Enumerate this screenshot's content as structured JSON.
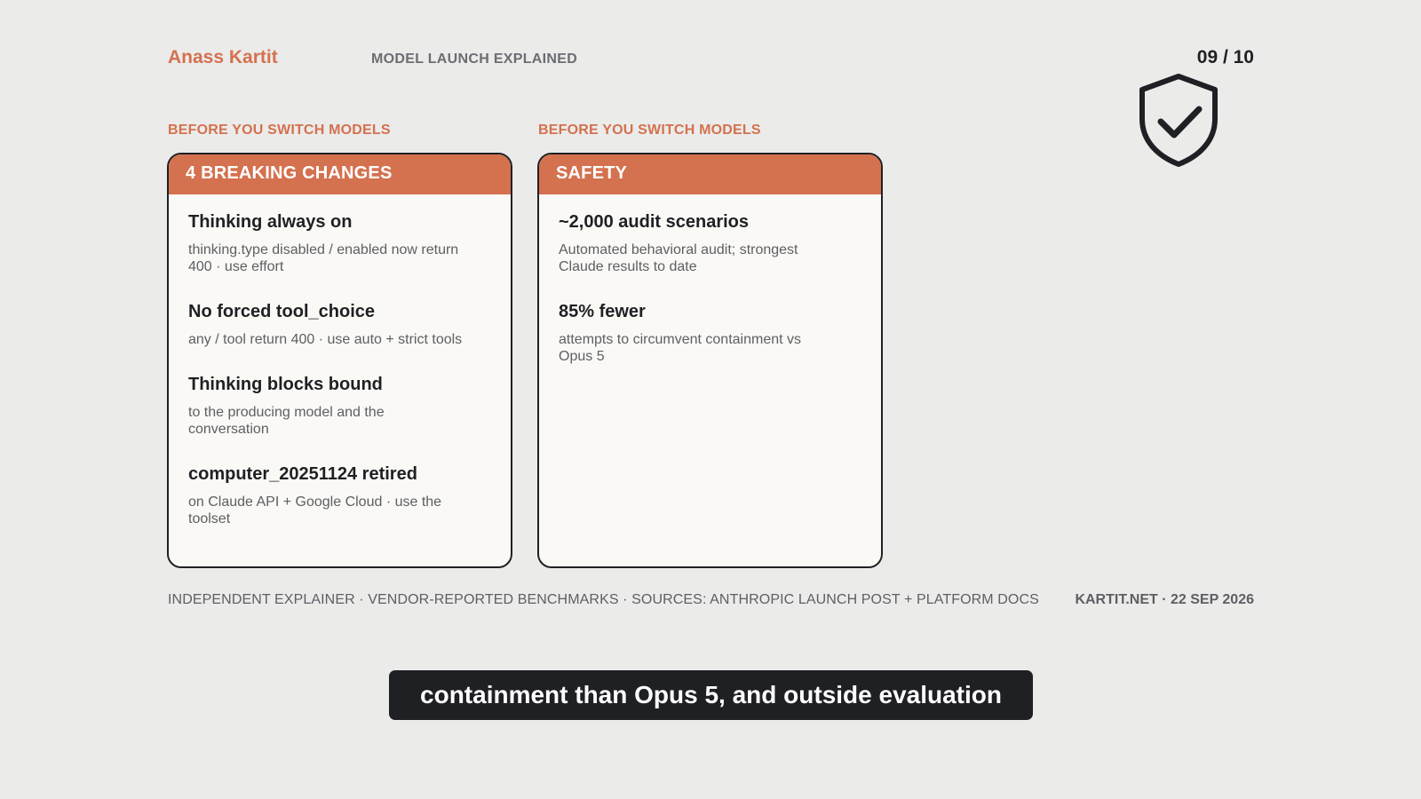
{
  "header": {
    "author": "Anass Kartit",
    "series": "MODEL LAUNCH EXPLAINED",
    "pager": "09 / 10",
    "icon": "shield-check-icon"
  },
  "columns": [
    {
      "label": "BEFORE YOU SWITCH MODELS",
      "title": "4 BREAKING CHANGES",
      "items": [
        {
          "title": "Thinking always on",
          "desc": "thinking.type disabled / enabled now return 400 · use effort"
        },
        {
          "title": "No forced tool_choice",
          "desc": "any / tool return 400 · use auto + strict tools"
        },
        {
          "title": "Thinking blocks bound",
          "desc": "to the producing model and the conversation"
        },
        {
          "title": "computer_20251124 retired",
          "desc": "on Claude API + Google Cloud · use the toolset"
        }
      ]
    },
    {
      "label": "BEFORE YOU SWITCH MODELS",
      "title": "SAFETY",
      "items": [
        {
          "title": "~2,000 audit scenarios",
          "desc": "Automated behavioral audit; strongest Claude results to date"
        },
        {
          "title": "85% fewer",
          "desc": "attempts to circumvent containment vs Opus 5"
        }
      ]
    }
  ],
  "footer": {
    "left": "INDEPENDENT EXPLAINER · VENDOR-REPORTED BENCHMARKS · SOURCES: ANTHROPIC LAUNCH POST + PLATFORM DOCS",
    "right": "KARTIT.NET · 22 SEP 2026"
  },
  "caption": "containment than Opus 5, and outside evaluation",
  "colors": {
    "accent": "#d4714f",
    "ink": "#1f2024",
    "background": "#ebebea",
    "card": "#faf9f5"
  }
}
